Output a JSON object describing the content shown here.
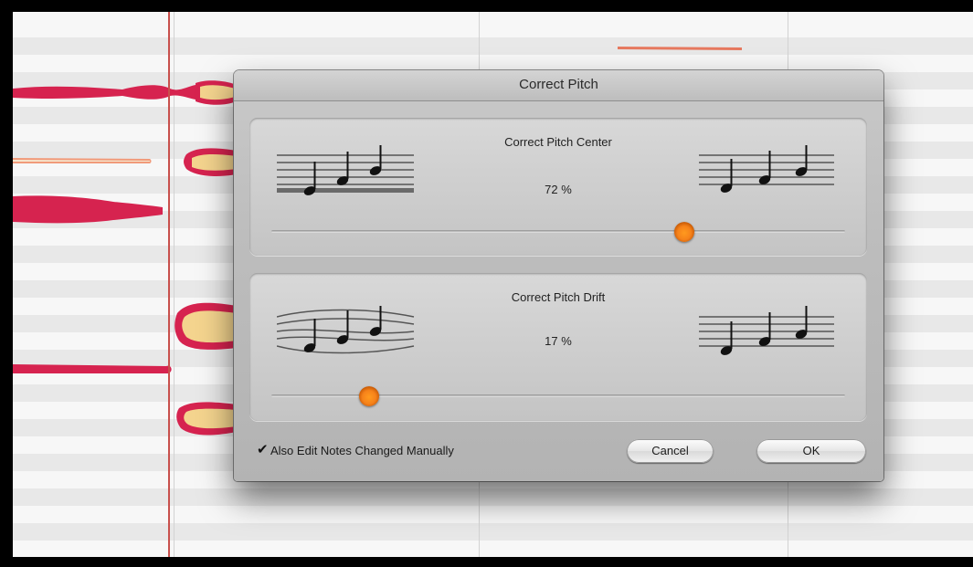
{
  "dialog": {
    "title": "Correct Pitch",
    "center": {
      "label": "Correct Pitch Center",
      "value_text": "72 %",
      "value": 72
    },
    "drift": {
      "label": "Correct Pitch Drift",
      "value_text": "17 %",
      "value": 17
    },
    "checkbox": {
      "label": "Also Edit Notes Changed Manually",
      "checked": true
    },
    "buttons": {
      "cancel": "Cancel",
      "ok": "OK"
    }
  },
  "colors": {
    "accent": "#f6821a",
    "note_blob": "#d6234f",
    "note_fill": "#f4d48e",
    "playhead": "#c8504c"
  }
}
